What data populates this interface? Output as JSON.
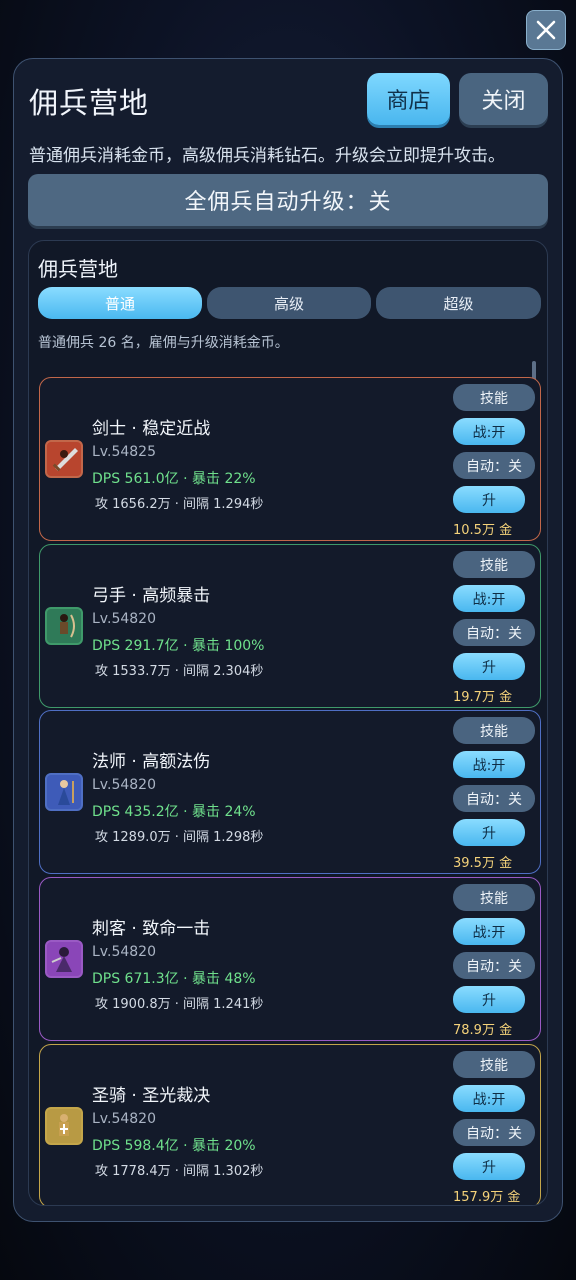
{
  "window": {
    "title": "佣兵营地",
    "close_icon": "close-icon"
  },
  "header": {
    "shop_label": "商店",
    "close_label": "关闭",
    "description": "普通佣兵消耗金币，高级佣兵消耗钻石。升级会立即提升攻击。",
    "auto_upgrade_label": "全佣兵自动升级：关"
  },
  "camp": {
    "title": "佣兵营地",
    "tabs": [
      {
        "label": "普通",
        "active": true
      },
      {
        "label": "高级",
        "active": false
      },
      {
        "label": "超级",
        "active": false
      }
    ],
    "count_text": "普通佣兵 26 名，雇佣与升级消耗金币。"
  },
  "mercenaries": [
    {
      "name": "剑士 · 稳定近战",
      "level": "Lv.54825",
      "dps": "DPS 561.0亿 · 暴击 22%",
      "atk": "攻 1656.2万 · 间隔 1.294秒",
      "skill_label": "技能",
      "battle_label": "战:开",
      "auto_label": "自动：关",
      "upgrade_label": "升",
      "cost": "10.5万 金",
      "border_color": "#c2674a",
      "avatar_color": "#b8452e",
      "icon": "swordsman-icon"
    },
    {
      "name": "弓手 · 高频暴击",
      "level": "Lv.54820",
      "dps": "DPS 291.7亿 · 暴击 100%",
      "atk": "攻 1533.7万 · 间隔 2.304秒",
      "skill_label": "技能",
      "battle_label": "战:开",
      "auto_label": "自动：关",
      "upgrade_label": "升",
      "cost": "19.7万 金",
      "border_color": "#3f9a6a",
      "avatar_color": "#2f7a58",
      "icon": "archer-icon"
    },
    {
      "name": "法师 · 高额法伤",
      "level": "Lv.54820",
      "dps": "DPS 435.2亿 · 暴击 24%",
      "atk": "攻 1289.0万 · 间隔 1.298秒",
      "skill_label": "技能",
      "battle_label": "战:开",
      "auto_label": "自动：关",
      "upgrade_label": "升",
      "cost": "39.5万 金",
      "border_color": "#4f6fc4",
      "avatar_color": "#3e5bb8",
      "icon": "mage-icon"
    },
    {
      "name": "刺客 · 致命一击",
      "level": "Lv.54820",
      "dps": "DPS 671.3亿 · 暴击 48%",
      "atk": "攻 1900.8万 · 间隔 1.241秒",
      "skill_label": "技能",
      "battle_label": "战:开",
      "auto_label": "自动：关",
      "upgrade_label": "升",
      "cost": "78.9万 金",
      "border_color": "#9a5ac4",
      "avatar_color": "#8a46b8",
      "icon": "assassin-icon"
    },
    {
      "name": "圣骑 · 圣光裁决",
      "level": "Lv.54820",
      "dps": "DPS 598.4亿 · 暴击 20%",
      "atk": "攻 1778.4万 · 间隔 1.302秒",
      "skill_label": "技能",
      "battle_label": "战:开",
      "auto_label": "自动：关",
      "upgrade_label": "升",
      "cost": "157.9万 金",
      "border_color": "#c4a64a",
      "avatar_color": "#b89a44",
      "icon": "paladin-icon"
    }
  ]
}
